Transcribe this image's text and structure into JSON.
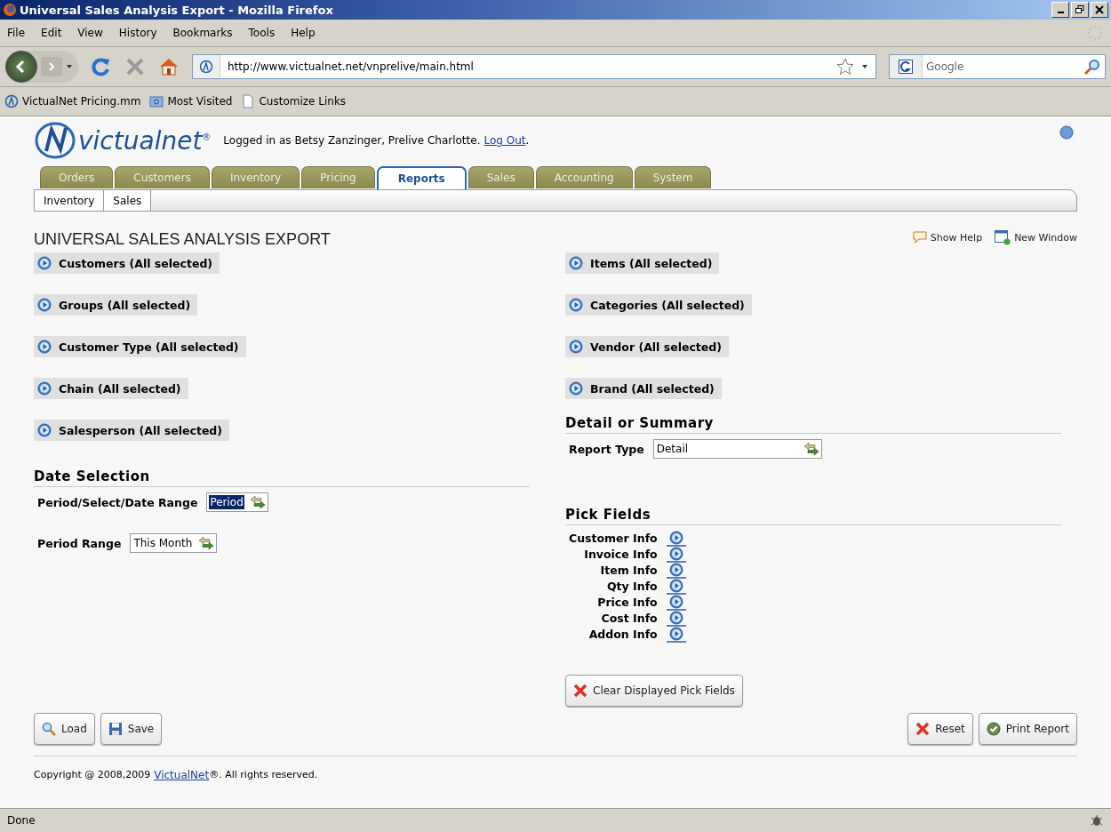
{
  "window": {
    "title": "Universal Sales Analysis Export - Mozilla Firefox"
  },
  "menu": [
    "File",
    "Edit",
    "View",
    "History",
    "Bookmarks",
    "Tools",
    "Help"
  ],
  "navigation": {
    "url": "http://www.victualnet.net/vnprelive/main.html",
    "search_placeholder": "Google"
  },
  "bookmarks": [
    "VictualNet Pricing.mm",
    "Most Visited",
    "Customize Links"
  ],
  "header": {
    "logo": "victualnet$^{®}$",
    "login_text": "Logged in as Betsy Zanzinger, Prelive Charlotte.",
    "logout_link": "Log Out",
    "logout_end": "."
  },
  "tabs": [
    {
      "label": "Orders",
      "selected": false
    },
    {
      "label": "Customers",
      "selected": false
    },
    {
      "label": "Inventory",
      "selected": false
    },
    {
      "label": "Pricing",
      "selected": false
    },
    {
      "label": "Reports",
      "selected": true
    },
    {
      "label": "Sales",
      "selected": false
    },
    {
      "label": "Accounting",
      "selected": false
    },
    {
      "label": "System",
      "selected": false
    }
  ],
  "subtabs": [
    "Inventory",
    "Sales"
  ],
  "page_title": "UNIVERSAL SALES ANALYSIS EXPORT",
  "page_links": [
    "Show Help",
    "New Window"
  ],
  "left_filters": [
    "Customers (All selected)",
    "Groups (All selected)",
    "Customer Type (All selected)",
    "Chain (All selected)",
    "Salesperson (All selected)"
  ],
  "right_filters": [
    "Items (All selected)",
    "Categories (All selected)",
    "Vendor (All selected)",
    "Brand (All selected)"
  ],
  "date_selection": {
    "title": "Date Selection",
    "fields": [
      {
        "label": "Period/Select/Date Range",
        "value": "Period",
        "highlighted": true
      },
      {
        "label": "Period Range",
        "value": "This Month",
        "highlighted": false
      }
    ]
  },
  "detail_or_summary": {
    "title": "Detail or Summary",
    "label": "Report Type",
    "value": "Detail"
  },
  "pick_fields": {
    "title": "Pick Fields",
    "items": [
      "Customer Info",
      "Invoice Info",
      "Item Info",
      "Qty Info",
      "Price Info",
      "Cost Info",
      "Addon Info"
    ],
    "clear_button": "Clear Displayed Pick Fields"
  },
  "buttons_left": [
    "Load",
    "Save"
  ],
  "buttons_right": [
    "Reset",
    "Print Report"
  ],
  "footer": {
    "text_before": "Copyright @ 2008,2009",
    "link": "VictualNet",
    "text_after": "®. All rights reserved."
  },
  "status_bar": "Done"
}
